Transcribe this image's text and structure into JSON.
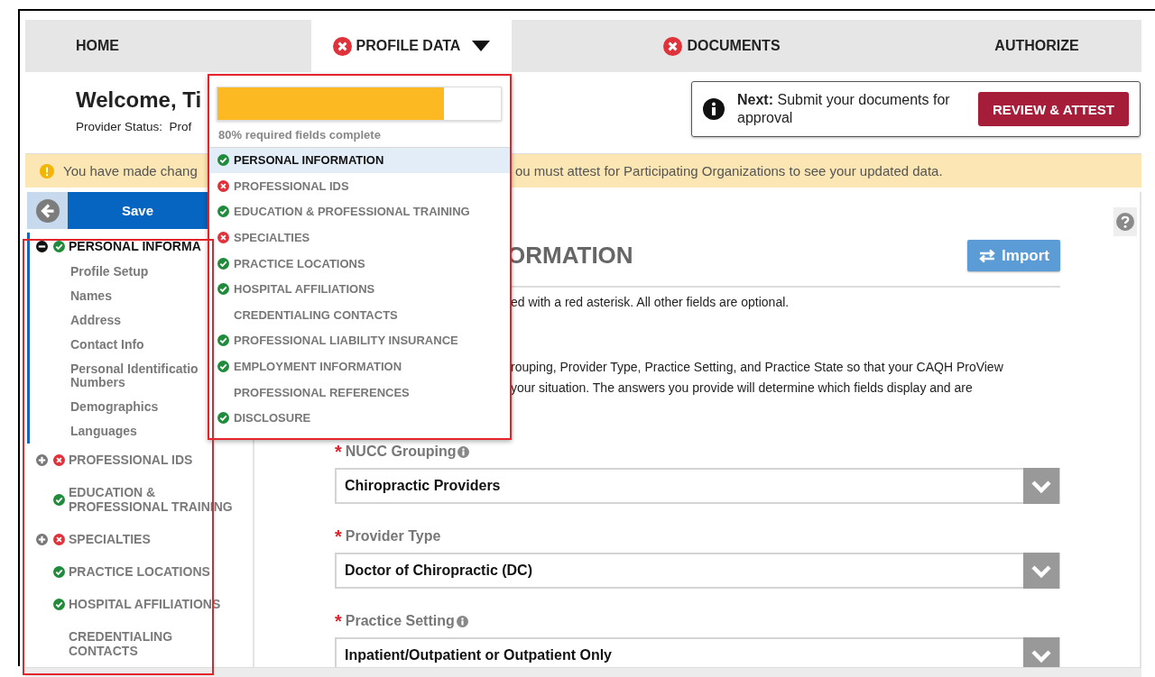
{
  "nav": {
    "tabs": [
      {
        "label": "HOME",
        "selected": false,
        "error": false,
        "menu": false
      },
      {
        "label": "PROFILE DATA",
        "selected": true,
        "error": true,
        "menu": true
      },
      {
        "label": "DOCUMENTS",
        "selected": false,
        "error": true,
        "menu": false
      },
      {
        "label": "AUTHORIZE",
        "selected": false,
        "error": false,
        "menu": false
      }
    ]
  },
  "header": {
    "welcome": "Welcome, Ti",
    "provider_status": "Provider Status:  Prof"
  },
  "next_panel": {
    "text": "**Next:** Submit your documents for approval",
    "button": "REVIEW & ATTEST"
  },
  "alert": {
    "text_left": "You have made chang",
    "text_right": "ou must attest for Participating Organizations to see your updated data."
  },
  "sidebar": {
    "save": "Save",
    "items": [
      {
        "label": "PERSONAL INFORMA",
        "kind": "complete",
        "selected": true,
        "expanded": true,
        "children": [
          {
            "label": "Profile Setup"
          },
          {
            "label": "Names"
          },
          {
            "label": "Address"
          },
          {
            "label": "Contact Info"
          },
          {
            "label": "Personal Identificatio\nNumbers"
          },
          {
            "label": "Demographics"
          },
          {
            "label": "Languages"
          }
        ]
      },
      {
        "label": "PROFESSIONAL IDS",
        "kind": "error",
        "selected": false,
        "expanded": false
      },
      {
        "label": "EDUCATION &\nPROFESSIONAL TRAINING",
        "kind": "complete",
        "selected": false
      },
      {
        "label": "SPECIALTIES",
        "kind": "error",
        "selected": false,
        "expanded": false
      },
      {
        "label": "PRACTICE LOCATIONS",
        "kind": "complete",
        "selected": false
      },
      {
        "label": "HOSPITAL AFFILIATIONS",
        "kind": "complete",
        "selected": false
      },
      {
        "label": "CREDENTIALING\nCONTACTS",
        "kind": "plain",
        "selected": false
      }
    ]
  },
  "main": {
    "heading": "ORMATION",
    "import_button": "Import",
    "note": "ed with a red asterisk. All other fields are optional.",
    "intro": "rouping, Provider Type, Practice Setting, and Practice State so that your CAQH ProView\nyour situation. The answers you provide will determine which fields display and are",
    "fields": [
      {
        "label": "NUCC Grouping",
        "required_mark": "*",
        "info": true,
        "value": "Chiropractic Providers"
      },
      {
        "label": "Provider Type",
        "required_mark": "*",
        "info": false,
        "value": "Doctor of Chiropractic (DC)"
      },
      {
        "label": "Practice Setting",
        "required_mark": "*",
        "info": true,
        "value": "Inpatient/Outpatient or Outpatient Only"
      }
    ]
  },
  "profile_menu": {
    "progress": {
      "level": 0.8
    },
    "progress_text": "80% required fields complete",
    "items": [
      {
        "label": "PERSONAL INFORMATION",
        "kind": "complete",
        "selected": true
      },
      {
        "label": "PROFESSIONAL IDS",
        "kind": "error",
        "selected": false
      },
      {
        "label": "EDUCATION & PROFESSIONAL TRAINING",
        "kind": "complete",
        "selected": false
      },
      {
        "label": "SPECIALTIES",
        "kind": "error",
        "selected": false
      },
      {
        "label": "PRACTICE LOCATIONS",
        "kind": "complete",
        "selected": false
      },
      {
        "label": "HOSPITAL AFFILIATIONS",
        "kind": "complete",
        "selected": false
      },
      {
        "label": "CREDENTIALING CONTACTS",
        "kind": "plain",
        "selected": false
      },
      {
        "label": "PROFESSIONAL LIABILITY INSURANCE",
        "kind": "complete",
        "selected": false
      },
      {
        "label": "EMPLOYMENT INFORMATION",
        "kind": "complete",
        "selected": false
      },
      {
        "label": "PROFESSIONAL REFERENCES",
        "kind": "plain",
        "selected": false
      },
      {
        "label": "DISCLOSURE",
        "kind": "complete",
        "selected": false
      }
    ]
  }
}
